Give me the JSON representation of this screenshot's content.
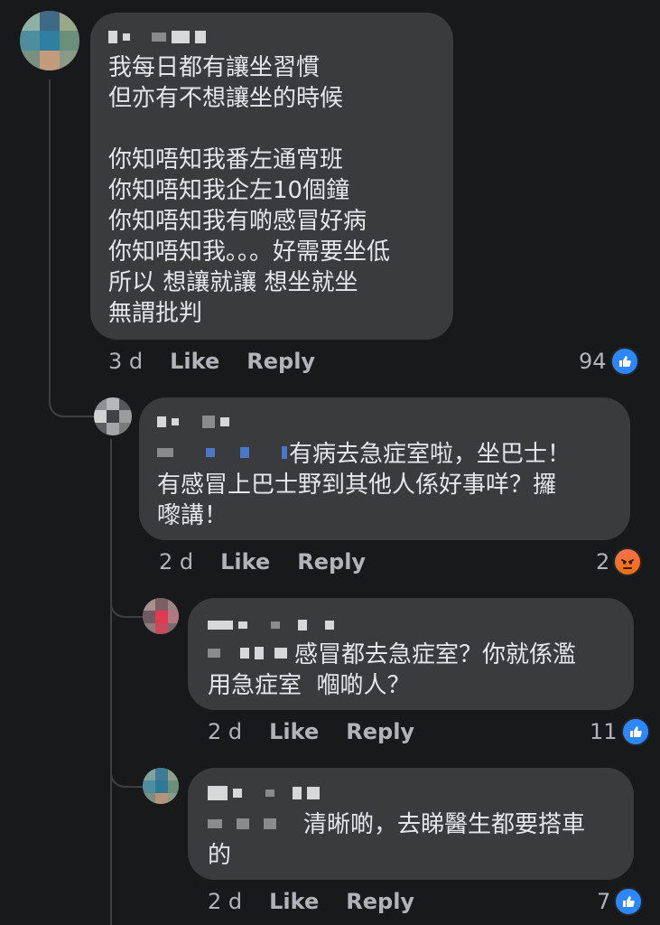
{
  "comments": [
    {
      "lines": [
        "我每日都有讓坐習慣",
        "但亦有不想讓坐的時候",
        "",
        "你知唔知我番左通宵班",
        "你知唔知我企左10個鐘",
        "你知唔知我有啲感冒好病",
        "你知唔知我。。。好需要坐低",
        "所以 想讓就讓 想坐就坐",
        "無謂批判"
      ],
      "time": "3 d",
      "like_label": "Like",
      "reply_label": "Reply",
      "reaction_count": "94",
      "reaction_icon": "like-icon"
    },
    {
      "lines": [
        "有病去急症室啦，坐巴士！",
        "有感冒上巴士野到其他人係好事咩？攞",
        "嚟講！"
      ],
      "time": "2 d",
      "like_label": "Like",
      "reply_label": "Reply",
      "reaction_count": "2",
      "reaction_icon": "angry-icon"
    },
    {
      "lines": [
        "感冒都去急症室？你就係濫",
        "用急症室  嗰啲人？"
      ],
      "time": "2 d",
      "like_label": "Like",
      "reply_label": "Reply",
      "reaction_count": "11",
      "reaction_icon": "like-icon"
    },
    {
      "lines": [
        "清晰啲，去睇醫生都要搭車",
        "的"
      ],
      "time": "2 d",
      "like_label": "Like",
      "reply_label": "Reply",
      "reaction_count": "7",
      "reaction_icon": "like-icon"
    }
  ],
  "colors": {
    "background": "#18191a",
    "bubble": "#3a3b3c",
    "like_blue": "#2d88ff",
    "meta_text": "#b0b3b8"
  }
}
